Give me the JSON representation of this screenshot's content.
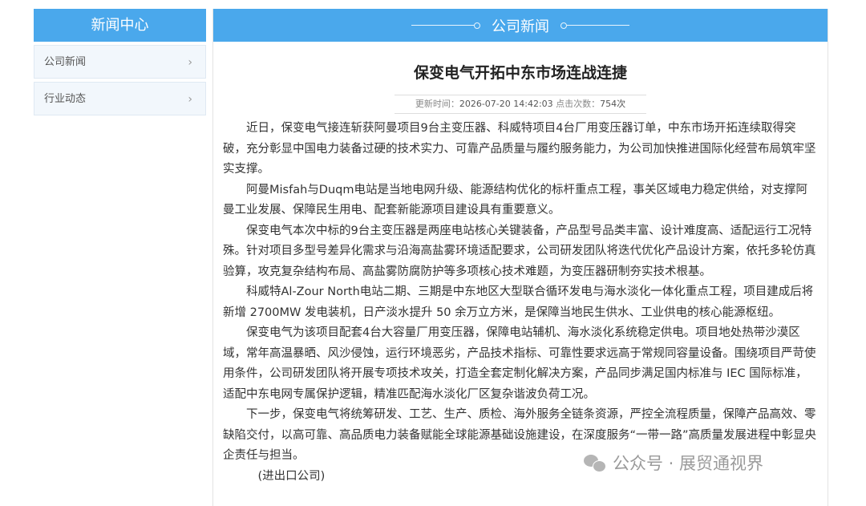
{
  "sidebar": {
    "title": "新闻中心",
    "items": [
      {
        "label": "公司新闻",
        "chevron": "›"
      },
      {
        "label": "行业动态",
        "chevron": "›"
      }
    ]
  },
  "header": {
    "title": "公司新闻"
  },
  "article": {
    "title": "保变电气开拓中东市场连战连捷",
    "meta": {
      "updated_label": "更新时间：",
      "updated_value": "2026-07-20 14:42:03",
      "clicks_label": "点击次数：",
      "clicks_value": "754次"
    },
    "paragraphs": [
      "近日，保变电气接连斩获阿曼项目9台主变压器、科威特项目4台厂用变压器订单，中东市场开拓连续取得突破，充分彰显中国电力装备过硬的技术实力、可靠产品质量与履约服务能力，为公司加快推进国际化经营布局筑牢坚实支撑。",
      "阿曼Misfah与Duqm电站是当地电网升级、能源结构优化的标杆重点工程，事关区域电力稳定供给，对支撑阿曼工业发展、保障民生用电、配套新能源项目建设具有重要意义。",
      "保变电气本次中标的9台主变压器是两座电站核心关键装备，产品型号品类丰富、设计难度高、适配运行工况特殊。针对项目多型号差异化需求与沿海高盐雾环境适配要求，公司研发团队将迭代优化产品设计方案，依托多轮仿真验算，攻克复杂结构布局、高盐雾防腐防护等多项核心技术难题，为变压器研制夯实技术根基。",
      "科威特Al-Zour North电站二期、三期是中东地区大型联合循环发电与海水淡化一体化重点工程，项目建成后将新增 2700MW 发电装机，日产淡水提升 50 余万立方米，是保障当地民生供水、工业供电的核心能源枢纽。",
      "保变电气为该项目配套4台大容量厂用变压器，保障电站辅机、海水淡化系统稳定供电。项目地处热带沙漠区域，常年高温暴晒、风沙侵蚀，运行环境恶劣，产品技术指标、可靠性要求远高于常规同容量设备。围绕项目严苛使用条件，公司研发团队将开展专项技术攻关，打造全套定制化解决方案，产品同步满足国内标准与 IEC 国际标准，适配中东电网专属保护逻辑，精准匹配海水淡化厂区复杂谐波负荷工况。",
      "下一步，保变电气将统筹研发、工艺、生产、质检、海外服务全链条资源，严控全流程质量，保障产品高效、零缺陷交付，以高可靠、高品质电力装备赋能全球能源基础设施建设，在深度服务“一带一路”高质量发展进程中彰显央企责任与担当。"
    ],
    "signature": "(进出口公司)"
  },
  "watermark": {
    "text": "公众号 · 展贸通视界",
    "icon": "wechat-icon"
  }
}
